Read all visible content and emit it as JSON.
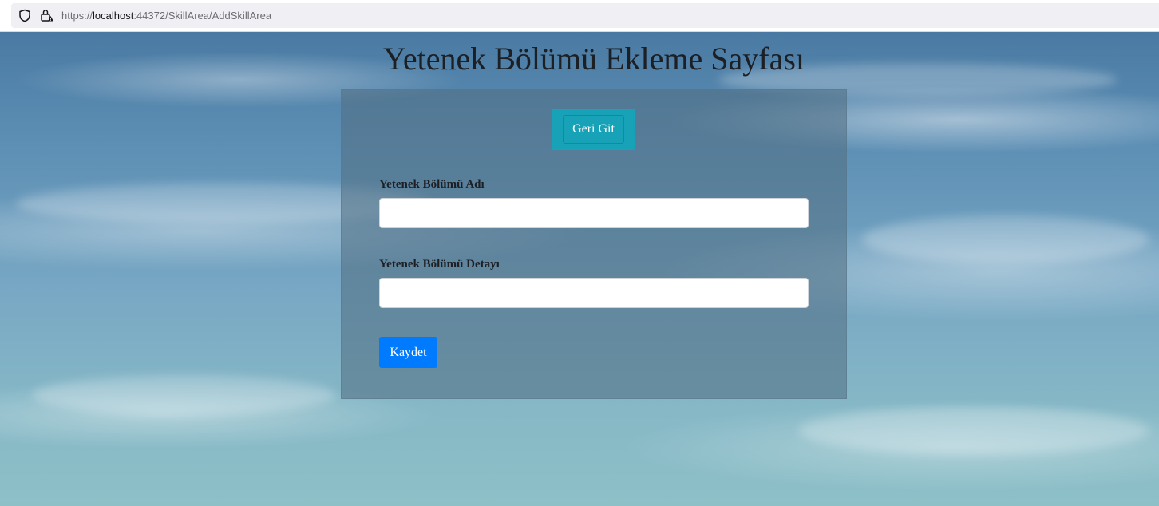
{
  "browser": {
    "url_scheme": "https://",
    "url_host": "localhost",
    "url_rest": ":44372/SkillArea/AddSkillArea"
  },
  "page": {
    "title": "Yetenek Bölümü Ekleme Sayfası"
  },
  "form": {
    "back_label": "Geri Git",
    "fields": [
      {
        "label": "Yetenek Bölümü Adı",
        "value": ""
      },
      {
        "label": "Yetenek Bölümü Detayı",
        "value": ""
      }
    ],
    "save_label": "Kaydet"
  },
  "colors": {
    "back_button_bg": "#17a2b8",
    "save_button_bg": "#007bff"
  },
  "icons": {
    "address_bar": [
      "shield-icon",
      "insecure-lock-icon"
    ]
  }
}
